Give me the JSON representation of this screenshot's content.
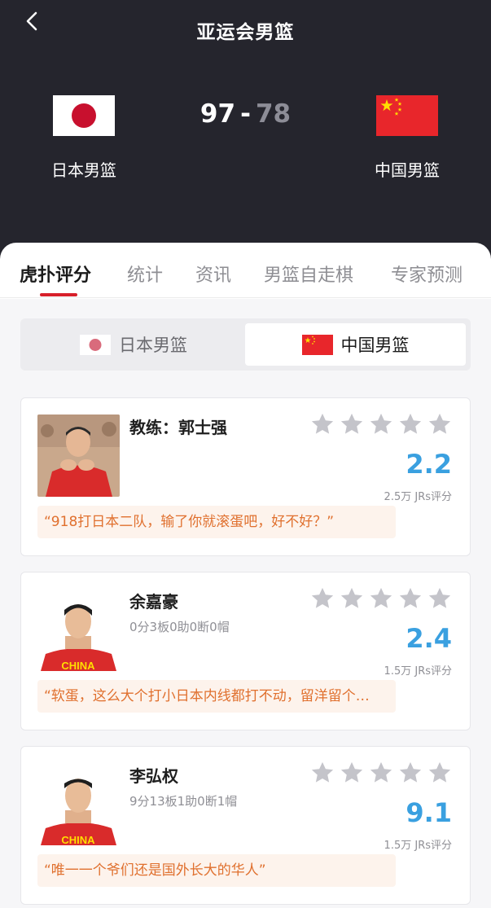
{
  "header": {
    "title": "亚运会男篮",
    "home_team": "日本男篮",
    "away_team": "中国男篮",
    "home_score": "97",
    "separator": "-",
    "away_score": "78"
  },
  "tabs": [
    {
      "label": "虎扑评分"
    },
    {
      "label": "统计"
    },
    {
      "label": "资讯"
    },
    {
      "label": "男篮自走棋"
    },
    {
      "label": "专家预测"
    }
  ],
  "team_switch": {
    "left": "日本男篮",
    "right": "中国男篮"
  },
  "ratings": [
    {
      "name": "教练：郭士强",
      "stats": "",
      "score": "2.2",
      "count": "2.5万 JRs评分",
      "comment": "“918打日本二队，输了你就滚蛋吧，好不好？”"
    },
    {
      "name": "余嘉豪",
      "stats": "0分3板0助0断0帽",
      "score": "2.4",
      "count": "1.5万 JRs评分",
      "comment": "“软蛋，这么大个打小日本内线都打不动，留洋留个…"
    },
    {
      "name": "李弘权",
      "stats": "9分13板1助0断1帽",
      "score": "9.1",
      "count": "1.5万 JRs评分",
      "comment": "“唯一一个爷们还是国外长大的华人”"
    }
  ],
  "colors": {
    "header_bg": "#25252d",
    "accent_red": "#d7202a",
    "rating_blue": "#3aa0e0",
    "comment_orange": "#e0702e",
    "star_gray": "#c4c4ca"
  }
}
